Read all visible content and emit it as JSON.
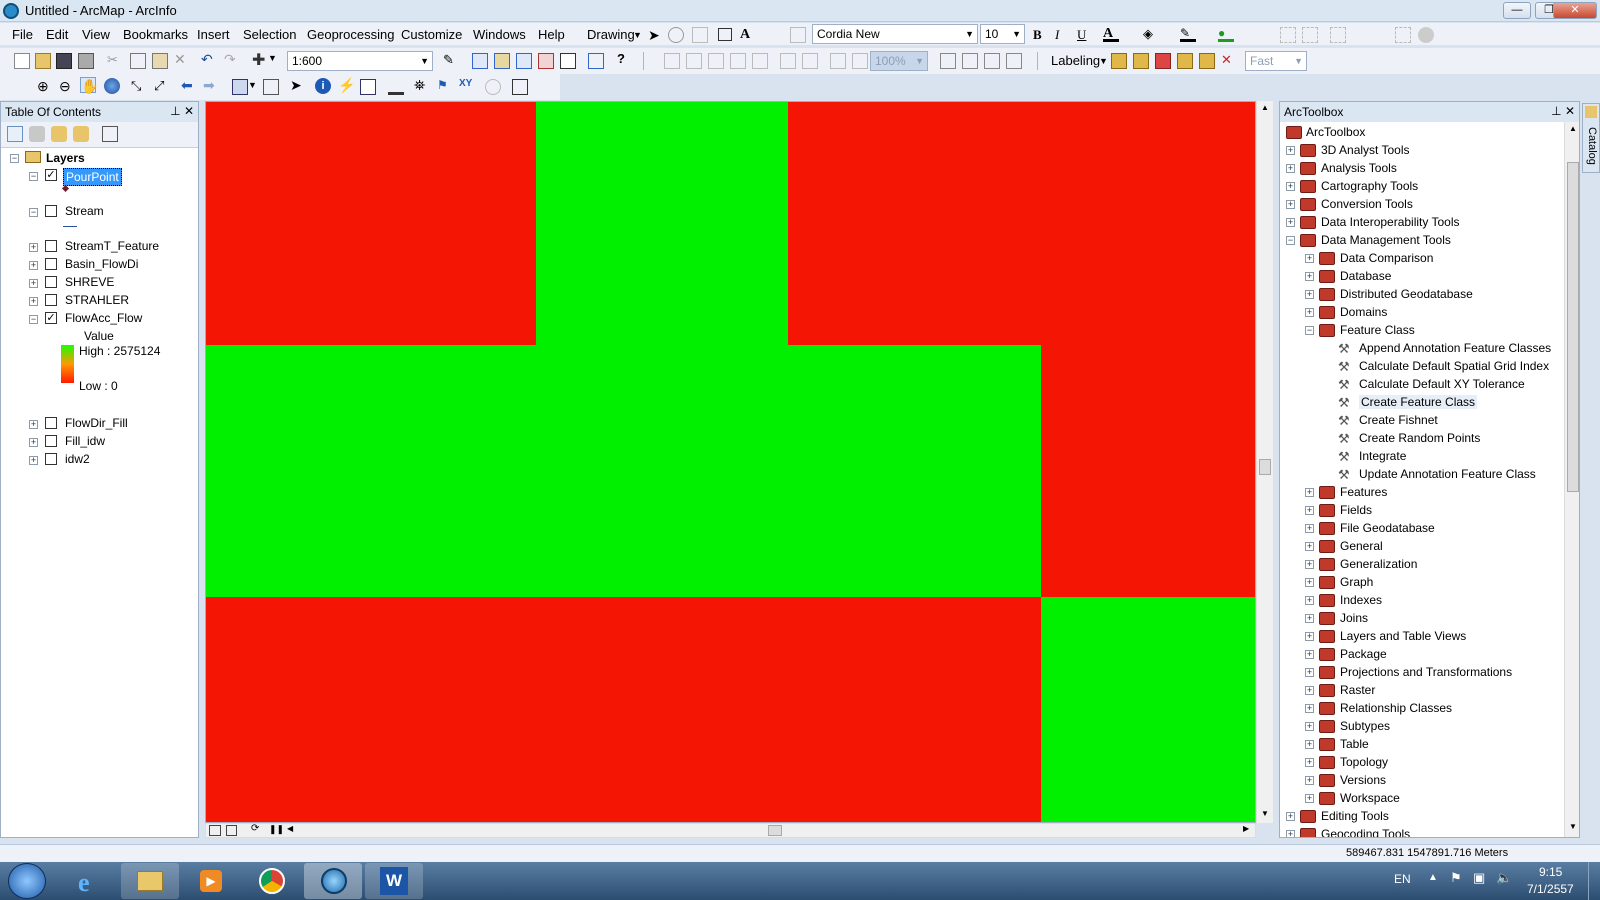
{
  "window": {
    "title": "Untitled - ArcMap - ArcInfo",
    "min": "—",
    "max": "❐",
    "close": "✕"
  },
  "menu": [
    "File",
    "Edit",
    "View",
    "Bookmarks",
    "Insert",
    "Selection",
    "Geoprocessing",
    "Customize",
    "Windows",
    "Help"
  ],
  "drawing": {
    "label": "Drawing",
    "font": "Cordia New",
    "size": "10",
    "bold": "B",
    "italic": "I",
    "underline": "U",
    "font_color": "A"
  },
  "standard": {
    "scale": "1:600"
  },
  "labeling": {
    "label": "Labeling",
    "mode": "Fast",
    "zoom": "100%"
  },
  "toc": {
    "title": "Table Of Contents",
    "root": "Layers",
    "layers": [
      {
        "name": "PourPoint",
        "checked": true,
        "selected": true
      },
      {
        "name": "Stream",
        "checked": false
      },
      {
        "name": "StreamT_Feature",
        "checked": false
      },
      {
        "name": "Basin_FlowDi",
        "checked": false
      },
      {
        "name": "SHREVE",
        "checked": false
      },
      {
        "name": "STRAHLER",
        "checked": false
      },
      {
        "name": "FlowAcc_Flow",
        "checked": true
      },
      {
        "name": "FlowDir_Fill",
        "checked": false
      },
      {
        "name": "Fill_idw",
        "checked": false
      },
      {
        "name": "idw2",
        "checked": false
      }
    ],
    "legend": {
      "value": "Value",
      "high": "High : 2575124",
      "low": "Low : 0"
    }
  },
  "map": {
    "color_red": "#f51505",
    "color_green": "#00f000"
  },
  "toolbox": {
    "title": "ArcToolbox",
    "root": "ArcToolbox",
    "top": [
      "3D Analyst Tools",
      "Analysis Tools",
      "Cartography Tools",
      "Conversion Tools",
      "Data Interoperability Tools",
      "Data Management Tools"
    ],
    "dm": [
      "Data Comparison",
      "Database",
      "Distributed Geodatabase",
      "Domains",
      "Feature Class"
    ],
    "fc_tools": [
      "Append Annotation Feature Classes",
      "Calculate Default Spatial Grid Index",
      "Calculate Default XY Tolerance",
      "Create Feature Class",
      "Create Fishnet",
      "Create Random Points",
      "Integrate",
      "Update Annotation Feature Class"
    ],
    "dm2": [
      "Features",
      "Fields",
      "File Geodatabase",
      "General",
      "Generalization",
      "Graph",
      "Indexes",
      "Joins",
      "Layers and Table Views",
      "Package",
      "Projections and Transformations",
      "Raster",
      "Relationship Classes",
      "Subtypes",
      "Table",
      "Topology",
      "Versions",
      "Workspace"
    ],
    "bottom": [
      "Editing Tools",
      "Geocoding Tools"
    ]
  },
  "catalog_tab": "Catalog",
  "status": {
    "coords": "589467.831  1547891.716 Meters"
  },
  "taskbar": {
    "lang": "EN",
    "time": "9:15",
    "date": "7/1/2557"
  }
}
